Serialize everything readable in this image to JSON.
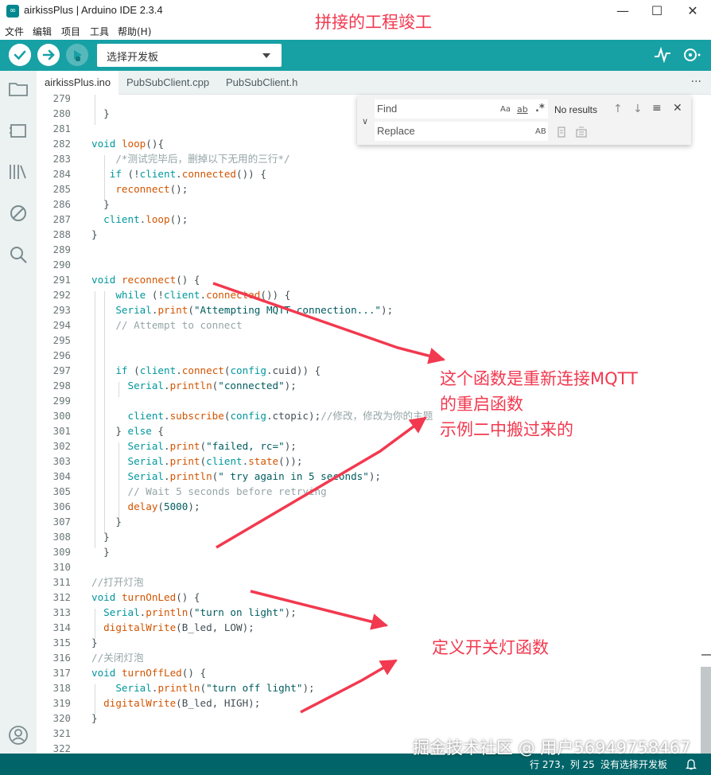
{
  "window": {
    "title": "airkissPlus | Arduino IDE 2.3.4",
    "app_icon": "∞",
    "minimize": "—",
    "maximize": "☐",
    "close": "✕"
  },
  "menu": [
    "文件",
    "编辑",
    "项目",
    "工具",
    "帮助(H)"
  ],
  "toolbar": {
    "verify_icon": "check-icon",
    "upload_icon": "arrow-right-icon",
    "debug_icon": "debug-icon",
    "board_placeholder": "选择开发板",
    "accent": "#17a1a5"
  },
  "tabs": [
    {
      "label": "airkissPlus.ino",
      "active": true
    },
    {
      "label": "PubSubClient.cpp",
      "active": false
    },
    {
      "label": "PubSubClient.h",
      "active": false
    }
  ],
  "tab_more": "···",
  "find": {
    "find_placeholder": "Find",
    "replace_placeholder": "Replace",
    "match_case": "Aa",
    "whole_word": "ab",
    "regex": ".*",
    "results": "No results",
    "preserve_case": "AB",
    "prev": "↑",
    "next": "↓",
    "selection": "≡",
    "close": "✕"
  },
  "code_lines": [
    {
      "n": "279",
      "text": ""
    },
    {
      "n": "280",
      "text": "  }"
    },
    {
      "n": "281",
      "text": ""
    },
    {
      "n": "282",
      "text": "void loop(){"
    },
    {
      "n": "283",
      "text": "    /*测试完毕后，删掉以下无用的三行*/"
    },
    {
      "n": "284",
      "text": "   if (!client.connected()) {"
    },
    {
      "n": "285",
      "text": "    reconnect();"
    },
    {
      "n": "286",
      "text": "  }"
    },
    {
      "n": "287",
      "text": "  client.loop();"
    },
    {
      "n": "288",
      "text": "}"
    },
    {
      "n": "289",
      "text": ""
    },
    {
      "n": "290",
      "text": ""
    },
    {
      "n": "291",
      "text": "void reconnect() {"
    },
    {
      "n": "292",
      "text": "    while (!client.connected()) {"
    },
    {
      "n": "293",
      "text": "    Serial.print(\"Attempting MQTT connection...\");"
    },
    {
      "n": "294",
      "text": "    // Attempt to connect"
    },
    {
      "n": "295",
      "text": ""
    },
    {
      "n": "296",
      "text": ""
    },
    {
      "n": "297",
      "text": "    if (client.connect(config.cuid)) {"
    },
    {
      "n": "298",
      "text": "      Serial.println(\"connected\");"
    },
    {
      "n": "299",
      "text": ""
    },
    {
      "n": "300",
      "text": "      client.subscribe(config.ctopic);//修改，修改为你的主题"
    },
    {
      "n": "301",
      "text": "    } else {"
    },
    {
      "n": "302",
      "text": "      Serial.print(\"failed, rc=\");"
    },
    {
      "n": "303",
      "text": "      Serial.print(client.state());"
    },
    {
      "n": "304",
      "text": "      Serial.println(\" try again in 5 seconds\");"
    },
    {
      "n": "305",
      "text": "      // Wait 5 seconds before retrying"
    },
    {
      "n": "306",
      "text": "      delay(5000);"
    },
    {
      "n": "307",
      "text": "    }"
    },
    {
      "n": "308",
      "text": "  }"
    },
    {
      "n": "309",
      "text": "  }"
    },
    {
      "n": "310",
      "text": ""
    },
    {
      "n": "311",
      "text": "//打开灯泡"
    },
    {
      "n": "312",
      "text": "void turnOnLed() {"
    },
    {
      "n": "313",
      "text": "  Serial.println(\"turn on light\");"
    },
    {
      "n": "314",
      "text": "  digitalWrite(B_led, LOW);"
    },
    {
      "n": "315",
      "text": "}"
    },
    {
      "n": "316",
      "text": "//关闭灯泡"
    },
    {
      "n": "317",
      "text": "void turnOffLed() {"
    },
    {
      "n": "318",
      "text": "    Serial.println(\"turn off light\");"
    },
    {
      "n": "319",
      "text": "  digitalWrite(B_led, HIGH);"
    },
    {
      "n": "320",
      "text": "}"
    },
    {
      "n": "321",
      "text": ""
    },
    {
      "n": "322",
      "text": ""
    }
  ],
  "status": {
    "position": "行 273，列 25",
    "board": "没有选择开发板",
    "bell_icon": "bell-icon"
  },
  "annotations": {
    "title_note": "拼接的工程竣工",
    "reconnect_note_1": "这个函数是重新连接MQTT",
    "reconnect_note_2": "的重启函数",
    "reconnect_note_3": "示例二中搬过来的",
    "led_note": "定义开关灯函数",
    "color": "#f2394f"
  },
  "watermark": "掘金技术社区 @ 用户56949758467"
}
